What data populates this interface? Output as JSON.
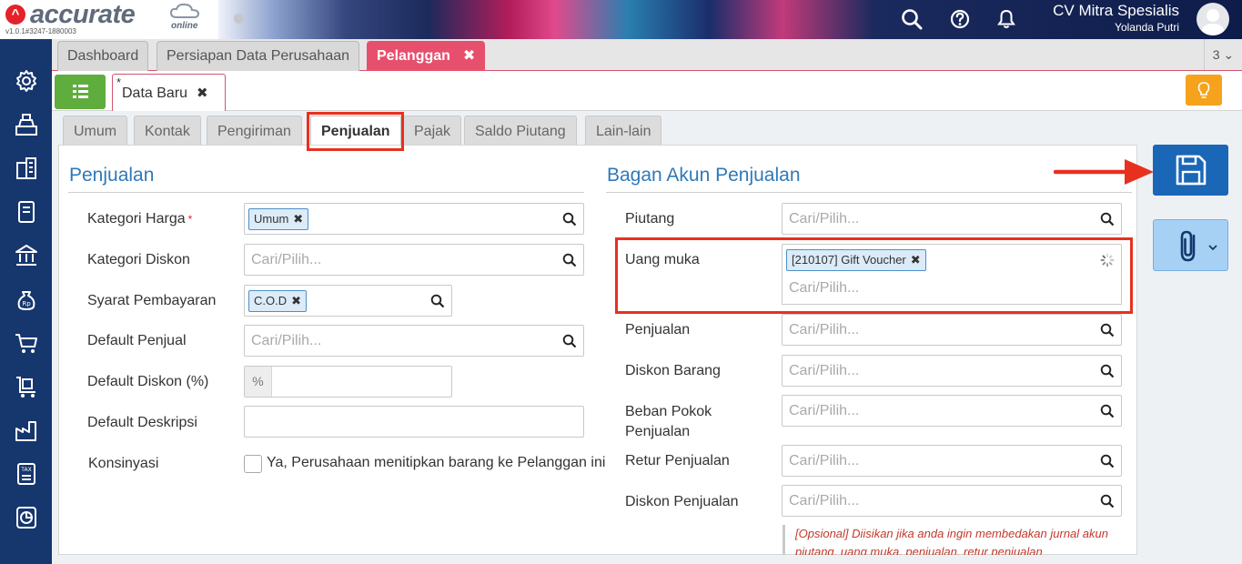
{
  "app": {
    "logo": "accurate",
    "logo_sub": "online",
    "version": "v1.0.1#3247-1880003",
    "company": "CV Mitra Spesialis",
    "user": "Yolanda Putri"
  },
  "page_tabs": [
    {
      "label": "Dashboard",
      "active": false
    },
    {
      "label": "Persiapan Data Perusahaan",
      "active": false
    },
    {
      "label": "Pelanggan",
      "active": true
    }
  ],
  "tab_count": "3",
  "doc_tab": {
    "marker": "*",
    "label": "Data Baru"
  },
  "form_tabs": [
    "Umum",
    "Kontak",
    "Pengiriman",
    "Penjualan",
    "Pajak",
    "Saldo Piutang",
    "Lain-lain"
  ],
  "active_form_tab": "Penjualan",
  "left_section": {
    "title": "Penjualan",
    "fields": {
      "kategori_harga": {
        "label": "Kategori Harga",
        "required": "*",
        "chip": "Umum"
      },
      "kategori_diskon": {
        "label": "Kategori Diskon",
        "placeholder": "Cari/Pilih..."
      },
      "syarat_pembayaran": {
        "label": "Syarat Pembayaran",
        "chip": "C.O.D"
      },
      "default_penjual": {
        "label": "Default Penjual",
        "placeholder": "Cari/Pilih..."
      },
      "default_diskon": {
        "label": "Default Diskon (%)",
        "addon": "%"
      },
      "default_deskripsi": {
        "label": "Default Deskripsi",
        "value": ""
      },
      "konsinyasi": {
        "label": "Konsinyasi",
        "checkbox_label": "Ya, Perusahaan menitipkan barang ke Pelanggan ini",
        "checked": false
      }
    }
  },
  "right_section": {
    "title": "Bagan Akun Penjualan",
    "fields": {
      "piutang": {
        "label": "Piutang",
        "placeholder": "Cari/Pilih..."
      },
      "uang_muka": {
        "label": "Uang muka",
        "chip": "[210107] Gift Voucher",
        "dropdown_placeholder": "Cari/Pilih..."
      },
      "penjualan": {
        "label": "Penjualan",
        "placeholder": "Cari/Pilih..."
      },
      "diskon_barang": {
        "label": "Diskon Barang",
        "placeholder": "Cari/Pilih..."
      },
      "beban_pokok_1": {
        "label": "Beban Pokok",
        "placeholder": "Cari/Pilih..."
      },
      "beban_pokok_2": {
        "label": "Penjualan"
      },
      "retur_penjualan": {
        "label": "Retur Penjualan",
        "placeholder": "Cari/Pilih..."
      },
      "diskon_penjualan": {
        "label": "Diskon Penjualan",
        "placeholder": "Cari/Pilih..."
      }
    },
    "note": "[Opsional] Diisikan jika anda ingin membedakan jurnal akun piutang, uang muka, penjualan, retur penjualan"
  },
  "colors": {
    "sidebar": "#16366e",
    "active_tab": "#e7506d",
    "save_button": "#1a66b7",
    "highlight": "#e8301f",
    "section_title": "#2f79b9"
  }
}
